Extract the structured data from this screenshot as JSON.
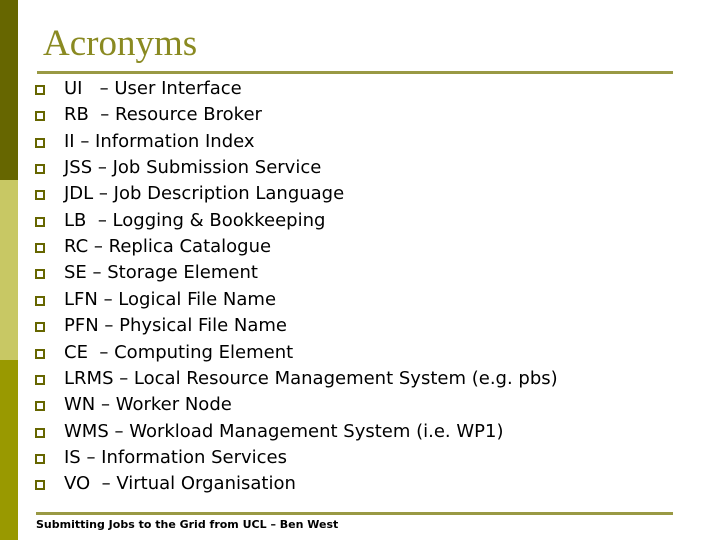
{
  "slide": {
    "title": "Acronyms",
    "items": [
      "UI   – User Interface",
      "RB  – Resource Broker",
      "II – Information Index",
      "JSS – Job Submission Service",
      "JDL – Job Description Language",
      "LB  – Logging & Bookkeeping",
      "RC – Replica Catalogue",
      "SE – Storage Element",
      "LFN – Logical File Name",
      "PFN – Physical File Name",
      "CE  – Computing Element",
      "LRMS – Local Resource Management System (e.g. pbs)",
      "WN – Worker Node",
      "WMS – Workload Management System (i.e. WP1)",
      "IS – Information Services",
      "VO  – Virtual Organisation"
    ],
    "bullet_icon": "hollow-square",
    "footer": "Submitting Jobs to the Grid from UCL – Ben West"
  },
  "colors": {
    "accent_dark": "#666600",
    "accent_light": "#c8c864",
    "accent_mid": "#999900",
    "title": "#8a8a22",
    "rule": "#999944"
  }
}
